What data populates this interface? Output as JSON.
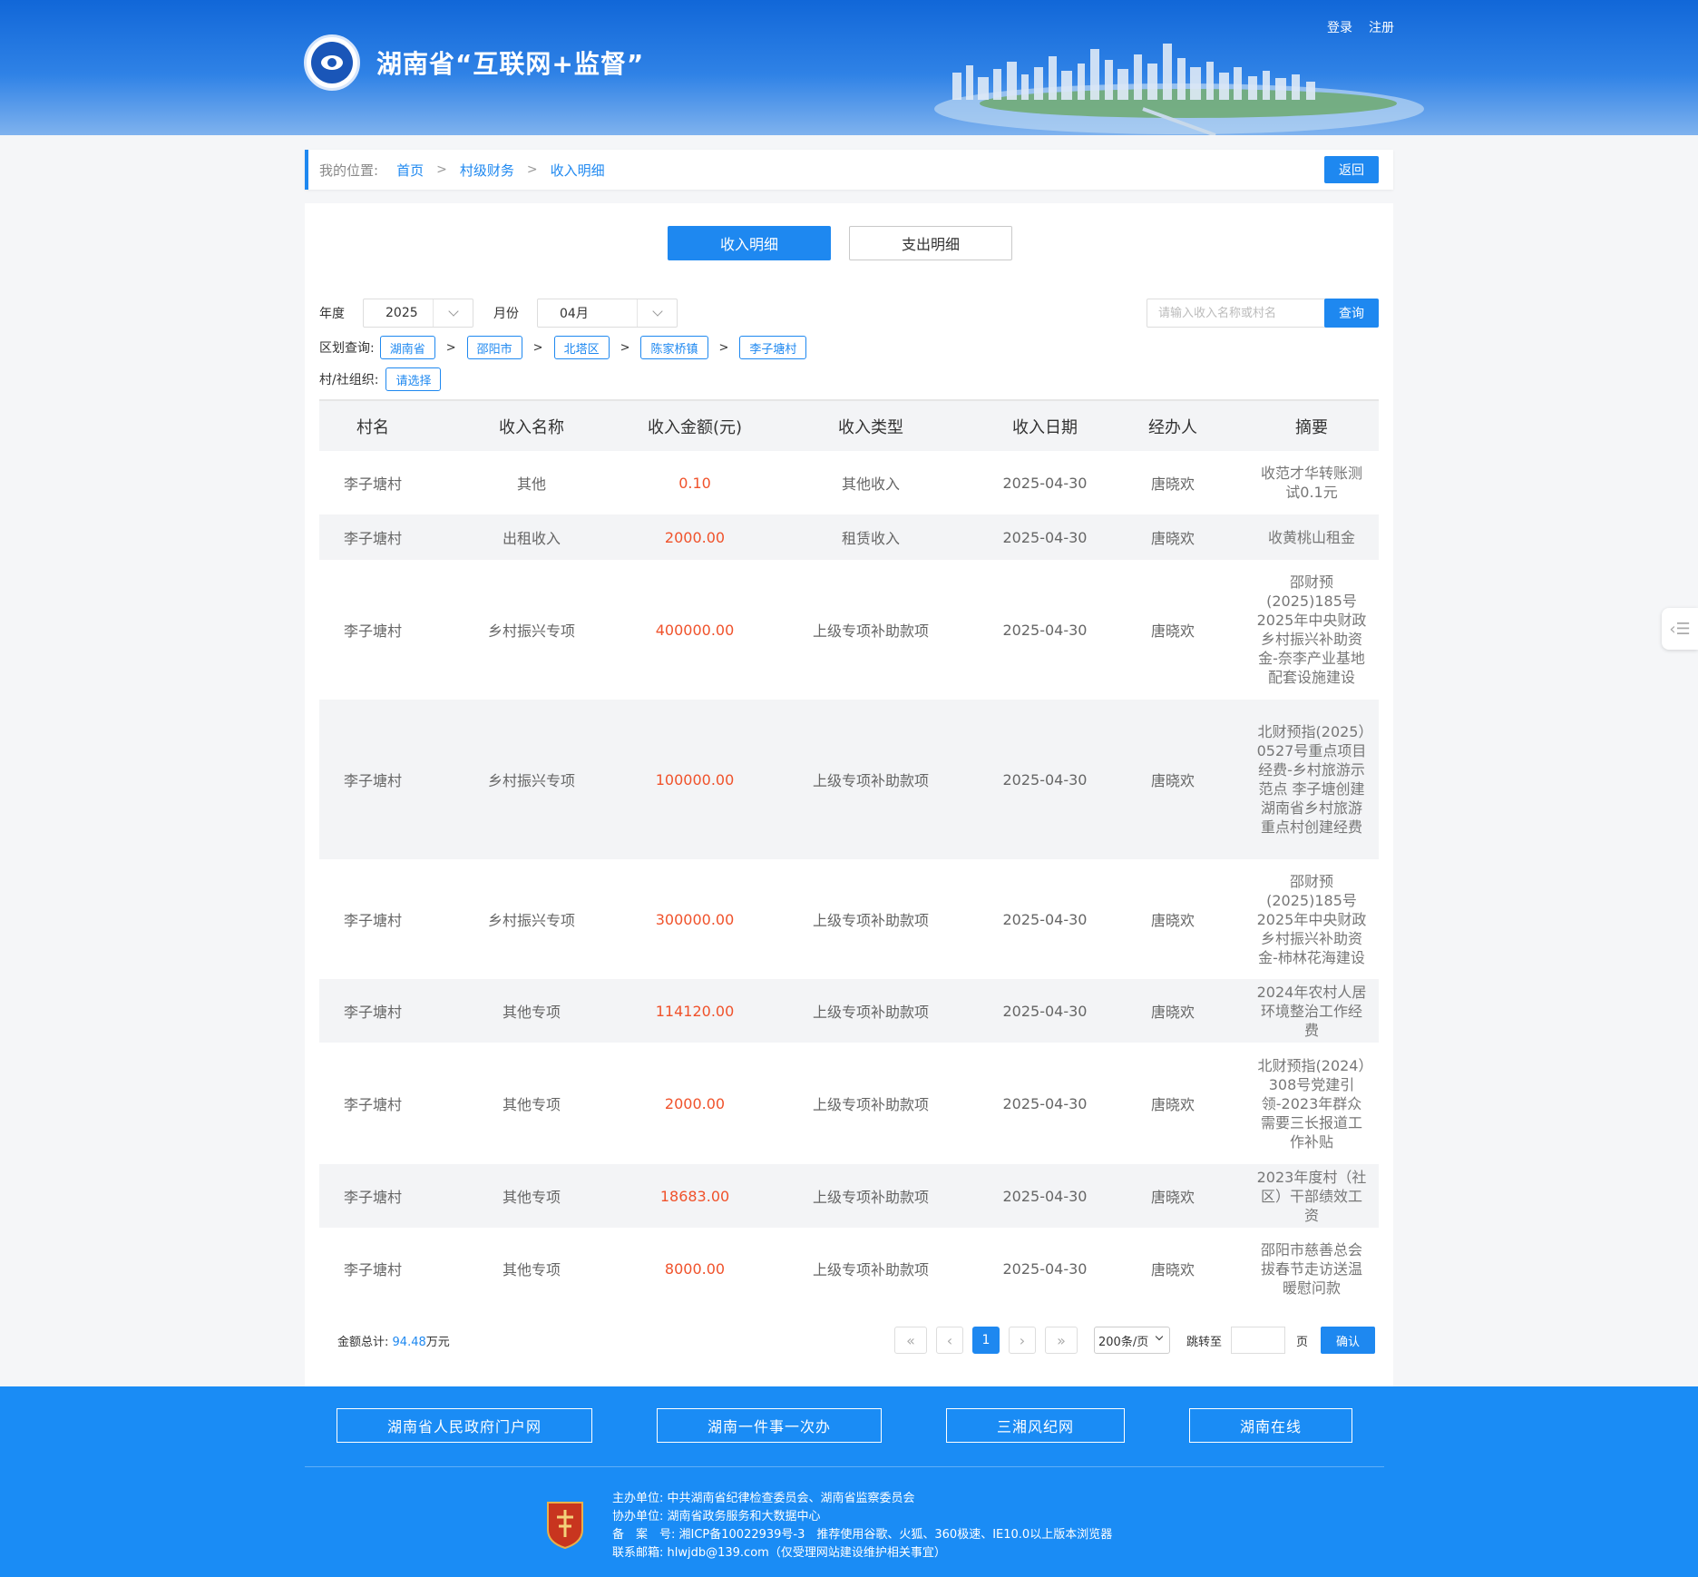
{
  "header": {
    "site_title": "湖南省“互联网+监督”",
    "login": "登录",
    "register": "注册"
  },
  "breadcrumb": {
    "label": "我的位置:",
    "items": [
      "首页",
      "村级财务",
      "收入明细"
    ],
    "separator": ">",
    "back": "返回"
  },
  "tabs": {
    "income": "收入明细",
    "expense": "支出明细"
  },
  "filters": {
    "year_label": "年度",
    "year_value": "2025",
    "month_label": "月份",
    "month_value": "04月",
    "search_placeholder": "请输入收入名称或村名",
    "query": "查询",
    "region_label": "区划查询:",
    "regions": [
      "湖南省",
      "邵阳市",
      "北塔区",
      "陈家桥镇",
      "李子塘村"
    ],
    "org_label": "村/社组织:",
    "org_value": "请选择"
  },
  "table": {
    "headers": [
      "村名",
      "收入名称",
      "收入金额(元)",
      "收入类型",
      "收入日期",
      "经办人",
      "摘要"
    ],
    "rows": [
      [
        "李子塘村",
        "其他",
        "0.10",
        "其他收入",
        "2025-04-30",
        "唐晓欢",
        "收范才华转账测试0.1元"
      ],
      [
        "李子塘村",
        "出租收入",
        "2000.00",
        "租赁收入",
        "2025-04-30",
        "唐晓欢",
        "收黄桃山租金"
      ],
      [
        "李子塘村",
        "乡村振兴专项",
        "400000.00",
        "上级专项补助款项",
        "2025-04-30",
        "唐晓欢",
        "邵财预(2025)185号2025年中央财政乡村振兴补助资金-奈李产业基地配套设施建设"
      ],
      [
        "李子塘村",
        "乡村振兴专项",
        "100000.00",
        "上级专项补助款项",
        "2025-04-30",
        "唐晓欢",
        "北财预指(2025）0527号重点项目经费-乡村旅游示范点 李子塘创建湖南省乡村旅游重点村创建经费"
      ],
      [
        "李子塘村",
        "乡村振兴专项",
        "300000.00",
        "上级专项补助款项",
        "2025-04-30",
        "唐晓欢",
        "邵财预(2025)185号2025年中央财政乡村振兴补助资金-柿林花海建设"
      ],
      [
        "李子塘村",
        "其他专项",
        "114120.00",
        "上级专项补助款项",
        "2025-04-30",
        "唐晓欢",
        "2024年农村人居环境整治工作经费"
      ],
      [
        "李子塘村",
        "其他专项",
        "2000.00",
        "上级专项补助款项",
        "2025-04-30",
        "唐晓欢",
        "北财预指(2024）308号党建引领-2023年群众需要三长报道工作补贴"
      ],
      [
        "李子塘村",
        "其他专项",
        "18683.00",
        "上级专项补助款项",
        "2025-04-30",
        "唐晓欢",
        "2023年度村（社区）干部绩效工资"
      ],
      [
        "李子塘村",
        "其他专项",
        "8000.00",
        "上级专项补助款项",
        "2025-04-30",
        "唐晓欢",
        "邵阳市慈善总会拔春节走访送温暖慰问款"
      ]
    ]
  },
  "pagination": {
    "total_label": "金额总计:",
    "total_value": "94.48",
    "total_unit": "万元",
    "first": "«",
    "prev": "‹",
    "current": "1",
    "next": "›",
    "last": "»",
    "page_size": "200条/页",
    "jump_label": "跳转至",
    "page_unit": "页",
    "confirm": "确认"
  },
  "footer": {
    "links": [
      "湖南省人民政府门户网",
      "湖南一件事一次办",
      "三湘风纪网",
      "湖南在线"
    ],
    "info": [
      "主办单位: 中共湖南省纪律检查委员会、湖南省监察委员会",
      "协办单位: 湖南省政务服务和大数据中心",
      "备　案　号: 湘ICP备10022939号-3　推荐使用谷歌、火狐、360极速、IE10.0以上版本浏览器",
      "联系邮箱: hlwjdb@139.com（仅受理网站建设维护相关事宜）"
    ]
  },
  "colors": {
    "primary": "#1e88f0",
    "amount": "#f0522b",
    "footer_bg": "#1a8cf5"
  }
}
